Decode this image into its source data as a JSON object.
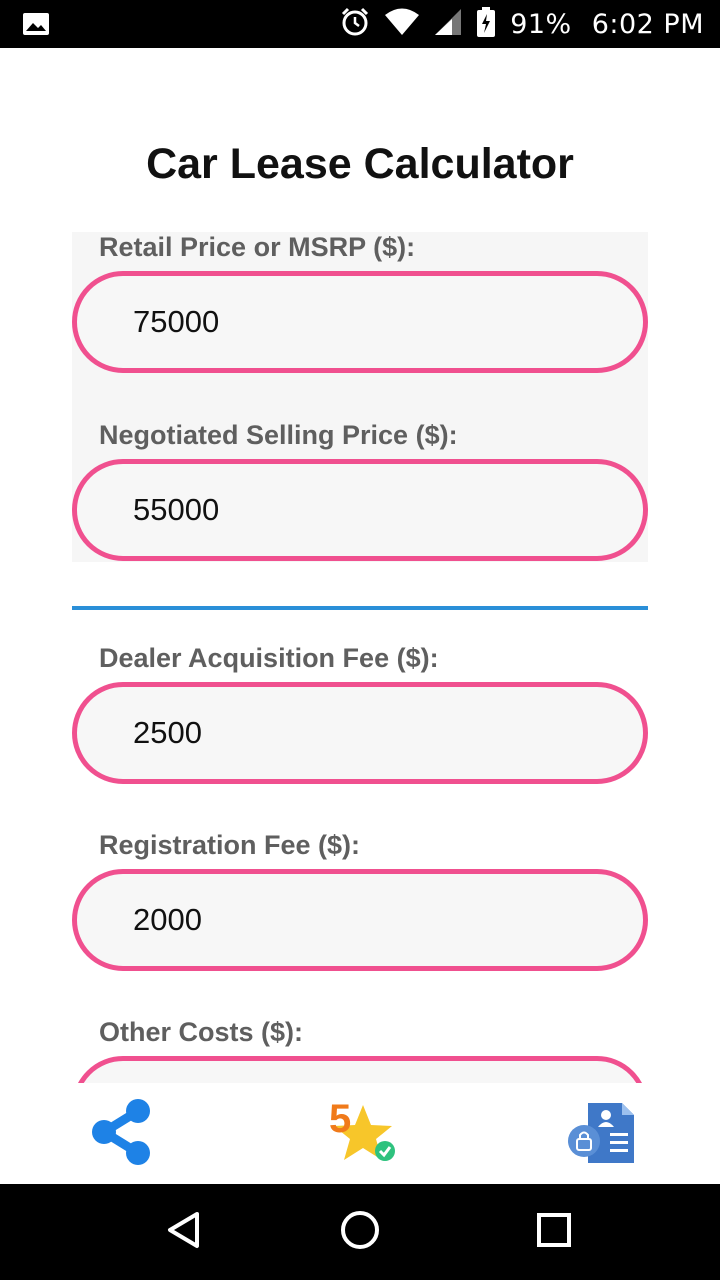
{
  "status_bar": {
    "battery": "91%",
    "time": "6:02 PM",
    "icons": [
      "image-icon",
      "alarm-icon",
      "wifi-icon",
      "signal-icon",
      "battery-icon"
    ]
  },
  "page": {
    "title": "Car Lease Calculator"
  },
  "fields": {
    "retail_price": {
      "label": "Retail Price or MSRP ($):",
      "value": "75000"
    },
    "selling_price": {
      "label": "Negotiated Selling Price ($):",
      "value": "55000"
    },
    "acquisition_fee": {
      "label": "Dealer Acquisition Fee ($):",
      "value": "2500"
    },
    "registration_fee": {
      "label": "Registration Fee ($):",
      "value": "2000"
    },
    "other_costs": {
      "label": "Other Costs ($):",
      "value": ""
    }
  },
  "toolbar": {
    "rate_badge": "5",
    "icons": [
      "share-icon",
      "rate-star-icon",
      "privacy-policy-icon"
    ]
  },
  "nav_bar": {
    "icons": [
      "back-icon",
      "home-icon",
      "recents-icon"
    ]
  },
  "colors": {
    "input_border": "#f0508f",
    "divider": "#2a8fd8",
    "share_blue": "#1e82e6",
    "star_yellow": "#f7c62a",
    "badge_orange": "#f07a1a"
  }
}
